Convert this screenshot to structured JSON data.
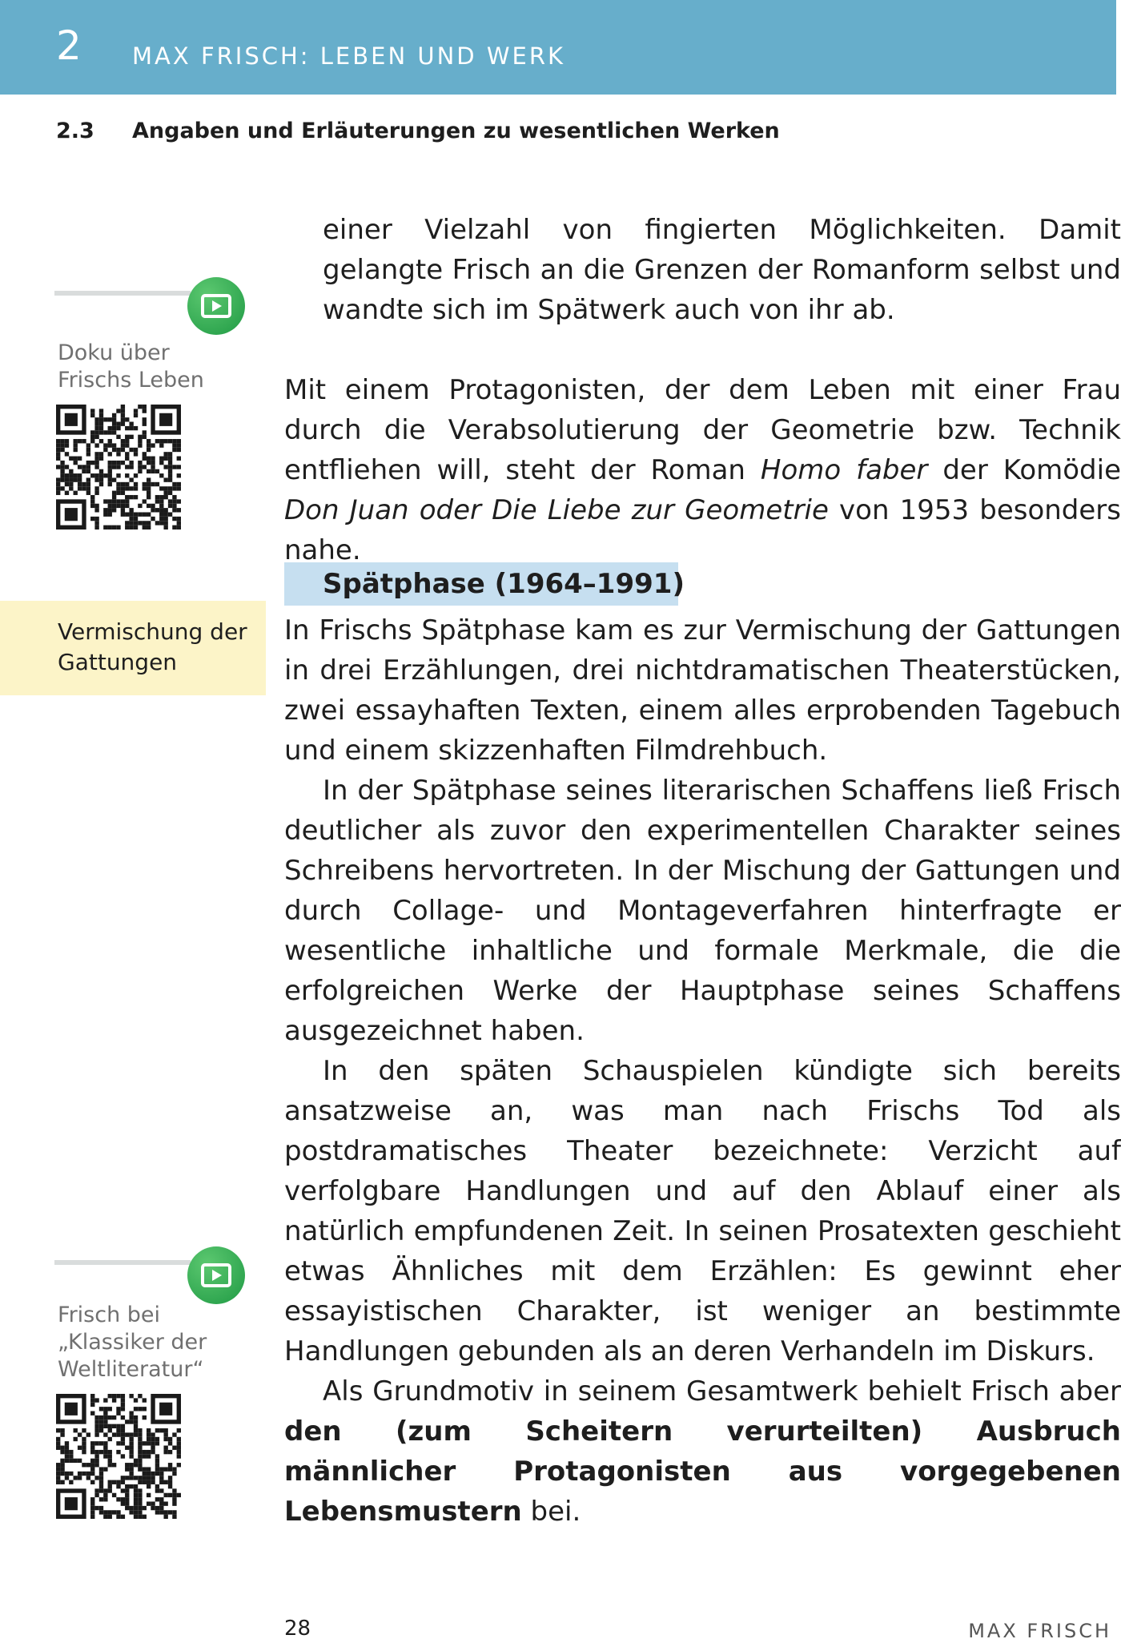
{
  "header": {
    "chapter_number": "2",
    "chapter_title": "MAX FRISCH: LEBEN UND WERK",
    "section_number": "2.3",
    "section_title": "Angaben und Erläuterungen zu wesentlichen Werken"
  },
  "sidebar": {
    "video1_label": "Doku über Frischs Leben",
    "keyword": "Vermischung der Gattungen",
    "video2_label": "Frisch bei „Klassiker der Weltliteratur“"
  },
  "main": {
    "p1": "einer Vielzahl von fingierten Möglichkeiten. Damit gelangte Frisch an die Grenzen der Romanform selbst und wandte sich im Spätwerk auch von ihr ab.",
    "p2_a": "Mit einem Protagonisten, der dem Leben mit einer Frau durch die Verabsolutierung der Geometrie bzw. Technik entfliehen will, steht der Roman ",
    "p2_italic1": "Homo faber",
    "p2_b": " der Komödie ",
    "p2_italic2": "Don Juan oder Die Liebe zur Geometrie",
    "p2_c": " von 1953 besonders nahe.",
    "heading": "Spätphase (1964–1991)",
    "p3": "In Frischs Spätphase kam es zur Vermischung der Gattungen in drei Erzählungen, drei nichtdramatischen Theaterstücken, zwei essayhaften Texten, einem alles erprobenden Tagebuch und einem skizzenhaften Filmdrehbuch.",
    "p4": "In der Spätphase seines literarischen Schaffens ließ Frisch deutlicher als zuvor den experimentellen Charakter seines Schreibens hervortreten. In der Mischung der Gattungen und durch Collage- und Montageverfahren hinterfragte er wesentliche inhaltliche und formale Merkmale, die die erfolgreichen Werke der Hauptphase seines Schaffens ausgezeichnet haben.",
    "p5": "In den späten Schauspielen kündigte sich bereits ansatzweise an, was man nach Frischs Tod als postdramatisches Theater bezeichnete: Verzicht auf verfolgbare Handlungen und auf den Ablauf einer als natürlich empfundenen Zeit. In seinen Prosatexten geschieht etwas Ähnliches mit dem Erzählen: Es gewinnt eher essayistischen Charakter, ist weniger an bestimmte Handlungen gebunden als an deren Verhandeln im Diskurs.",
    "p6_a": "Als Grundmotiv in seinem Gesamtwerk behielt Frisch aber ",
    "p6_bold": "den (zum Scheitern verurteilten) Ausbruch männlicher Protagonisten aus vorgegebenen Lebensmustern",
    "p6_b": " bei."
  },
  "footer": {
    "page_number": "28",
    "book_title": "MAX FRISCH"
  },
  "colors": {
    "header_bg": "#67aecb",
    "heading_bg": "#c6dff0",
    "keyword_bg": "#fcf4c8",
    "video_green": "#2fae52"
  },
  "icons": {
    "video_button": "play-video-icon",
    "qr": "qr-code"
  }
}
